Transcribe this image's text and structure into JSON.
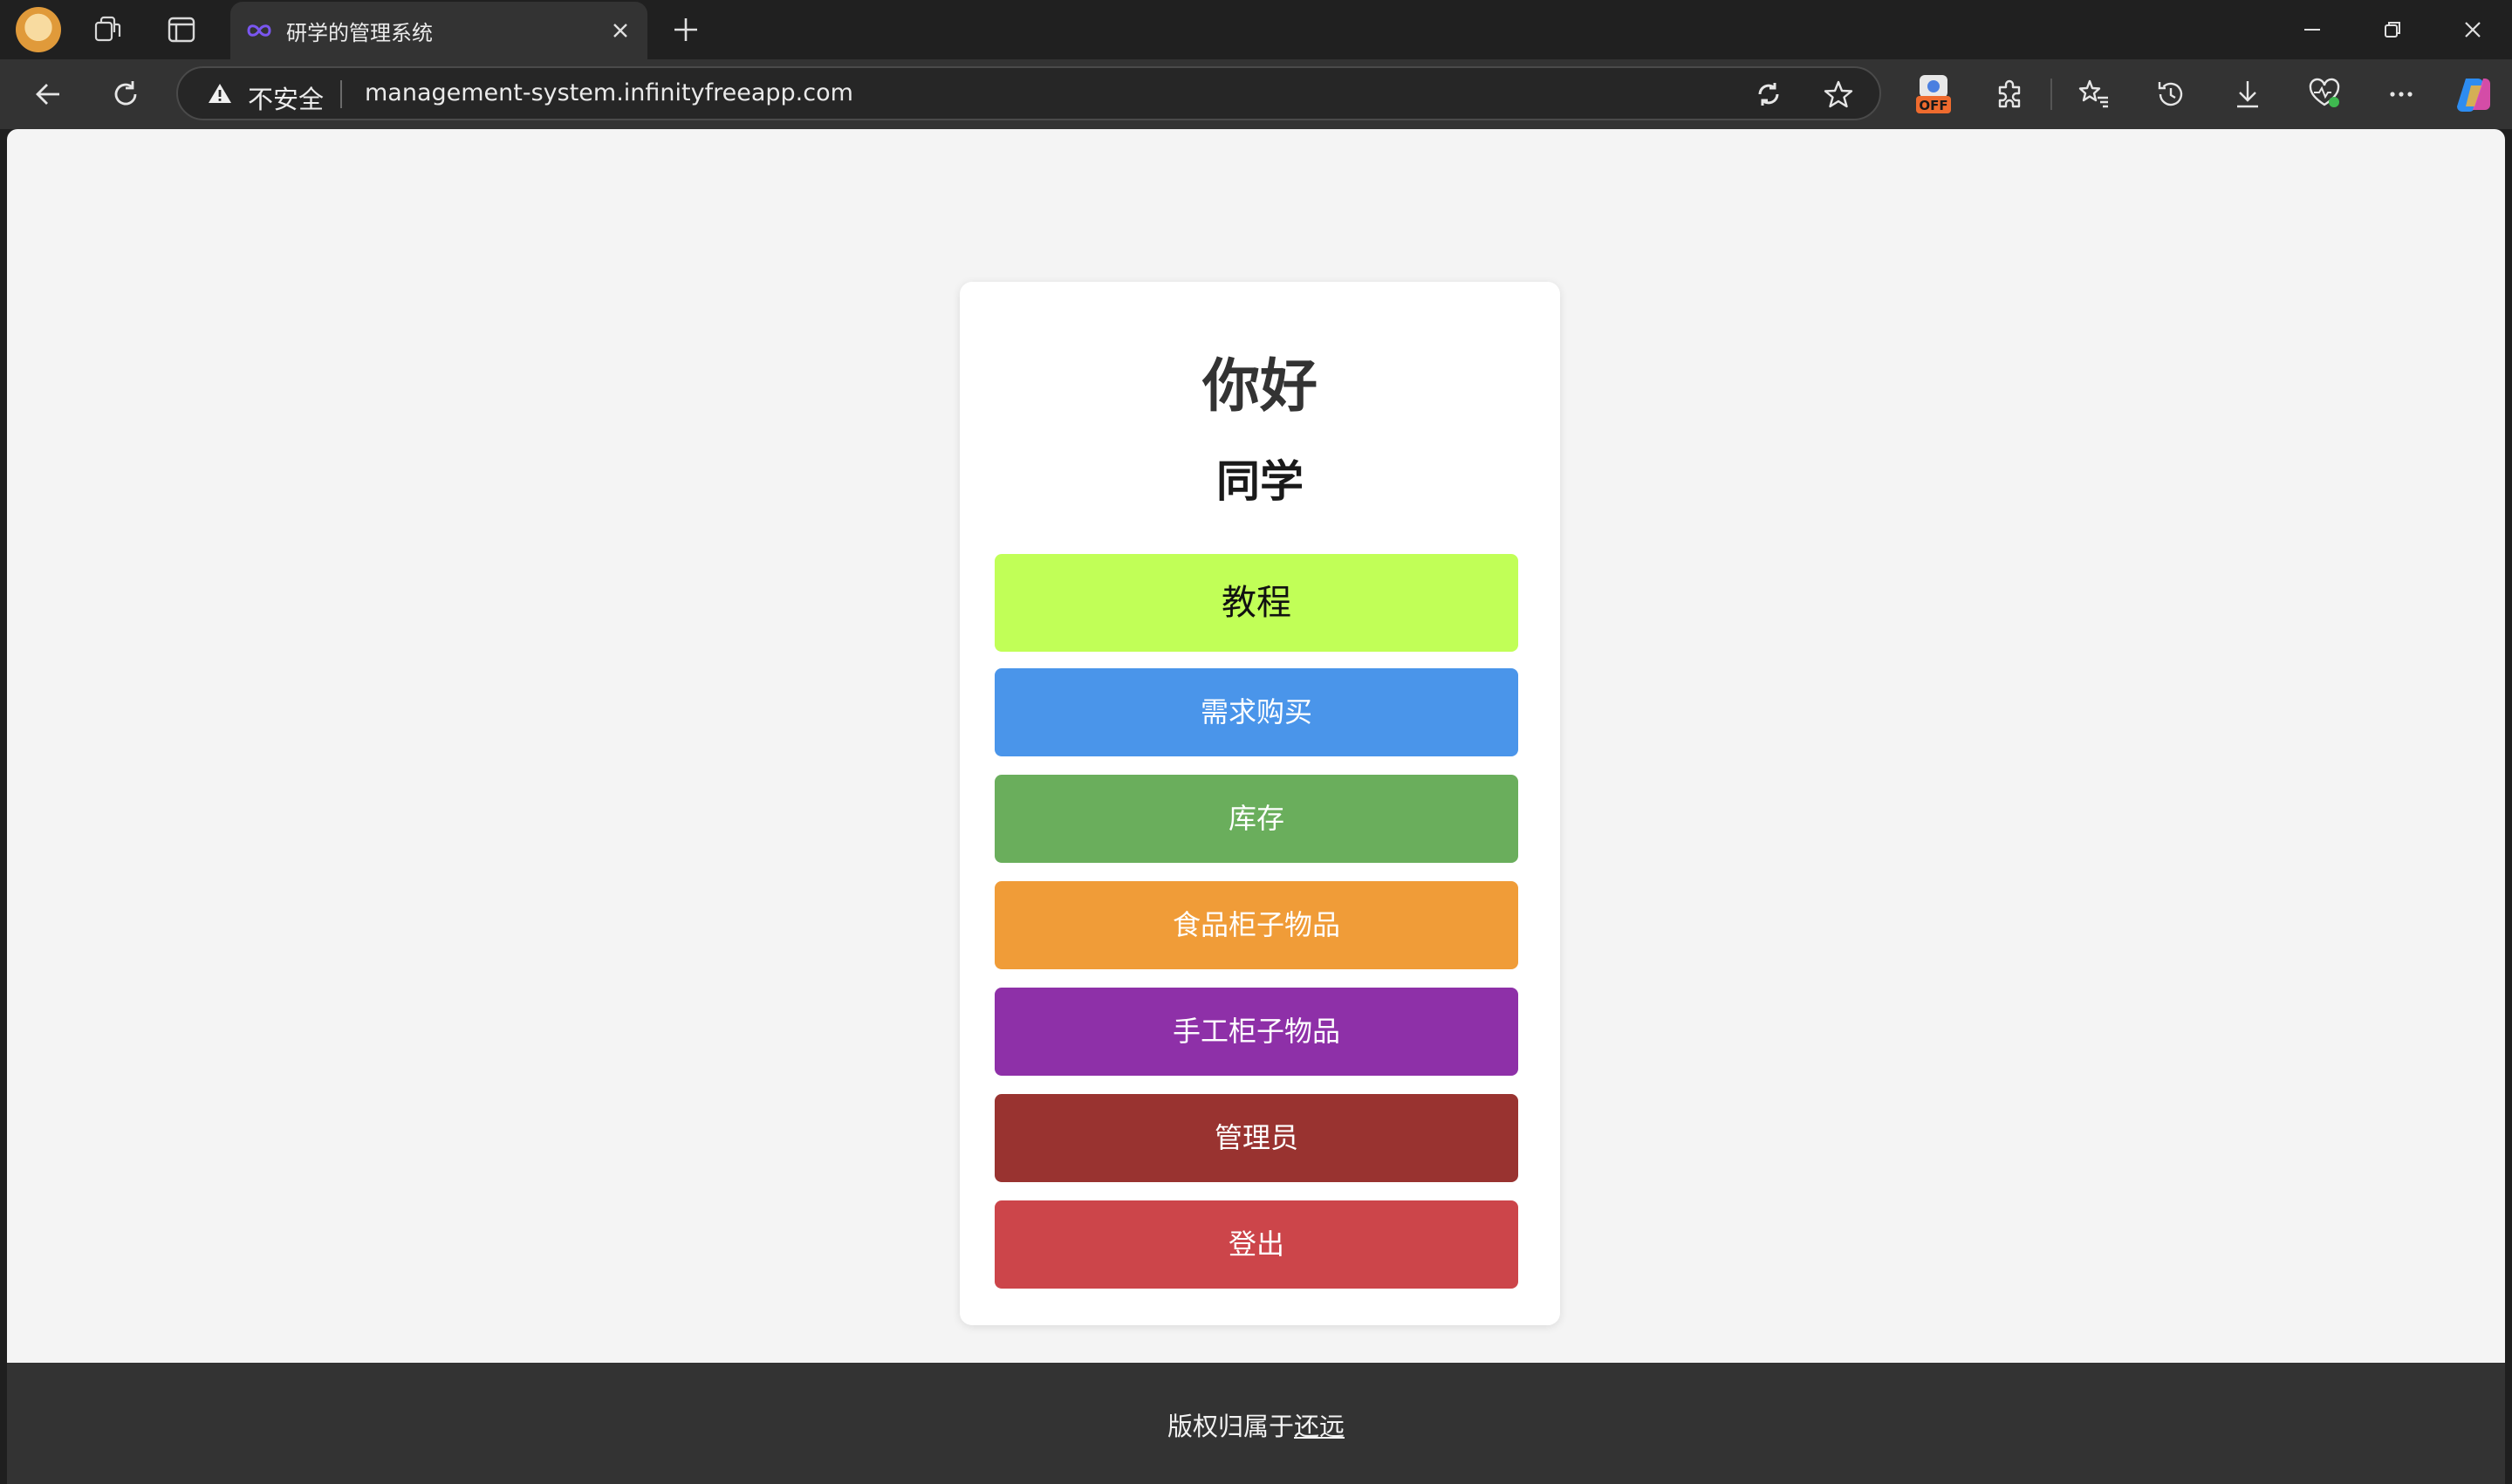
{
  "browser": {
    "tab_title": "研学的管理系统",
    "security_label": "不安全",
    "url": "management-system.infinityfreeapp.com",
    "extension_badge": "OFF"
  },
  "page": {
    "greeting": "你好",
    "role": "同学",
    "buttons": [
      {
        "label": "教程",
        "color": "#c1ff57",
        "text_color": "#111111"
      },
      {
        "label": "需求购买",
        "color": "#4a95ea",
        "text_color": "#ffffff"
      },
      {
        "label": "库存",
        "color": "#6aae5c",
        "text_color": "#ffffff"
      },
      {
        "label": "食品柜子物品",
        "color": "#f09c38",
        "text_color": "#ffffff"
      },
      {
        "label": "手工柜子物品",
        "color": "#8e30a8",
        "text_color": "#ffffff"
      },
      {
        "label": "管理员",
        "color": "#993330",
        "text_color": "#ffffff"
      },
      {
        "label": "登出",
        "color": "#cc454a",
        "text_color": "#ffffff"
      }
    ],
    "footer_prefix": "版权归属于",
    "footer_link": "还远"
  }
}
